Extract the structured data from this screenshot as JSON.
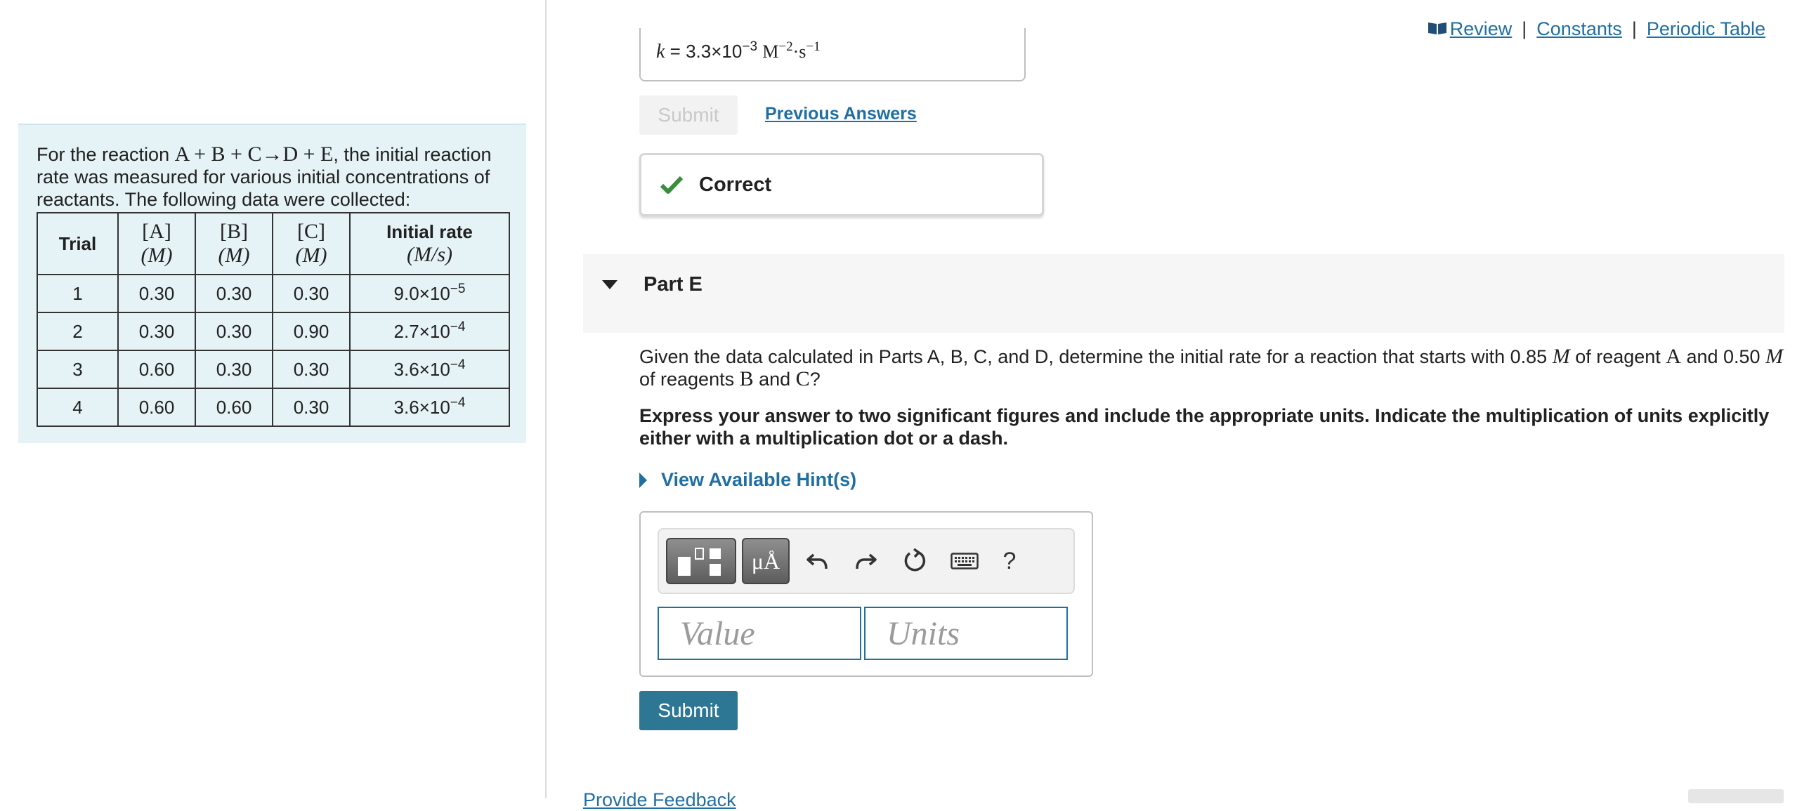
{
  "links": {
    "review": "Review",
    "separator": "|",
    "constants": "Constants",
    "periodic_table": "Periodic Table"
  },
  "problem": {
    "intro_before": "For the reaction ",
    "reaction": "A + B + C→D + E",
    "intro_after": ", the initial reaction rate was measured for various initial concentrations of reactants. The following data were collected:",
    "table": {
      "headers": {
        "trial": "Trial",
        "a": "[A]",
        "b": "[B]",
        "c": "[C]",
        "conc_unit": "(M)",
        "rate": "Initial rate",
        "rate_unit": "(M/s)"
      },
      "rows": [
        {
          "trial": "1",
          "a": "0.30",
          "b": "0.30",
          "c": "0.30",
          "rate_base": "9.0×10",
          "rate_exp": "−5"
        },
        {
          "trial": "2",
          "a": "0.30",
          "b": "0.30",
          "c": "0.90",
          "rate_base": "2.7×10",
          "rate_exp": "−4"
        },
        {
          "trial": "3",
          "a": "0.60",
          "b": "0.30",
          "c": "0.30",
          "rate_base": "3.6×10",
          "rate_exp": "−4"
        },
        {
          "trial": "4",
          "a": "0.60",
          "b": "0.60",
          "c": "0.30",
          "rate_base": "3.6×10",
          "rate_exp": "−4"
        }
      ]
    }
  },
  "previous": {
    "k_label": "k",
    "equals": "=",
    "value_base": "3.3×10",
    "value_exp": "−3",
    "unit_m": "M",
    "unit_m_exp": "−2",
    "unit_dot_s": "·s",
    "unit_s_exp": "−1",
    "submit_label": "Submit",
    "previous_answers_label": "Previous Answers",
    "feedback": "Correct"
  },
  "part": {
    "title": "Part E",
    "question_1": "Given the data calculated in Parts A, B, C, and D, determine the initial rate for a reaction that starts with 0.85 ",
    "question_m1": "M",
    "question_2": " of reagent ",
    "question_a": "A",
    "question_3": " and 0.50 ",
    "question_m2": "M",
    "question_4": " of reagents ",
    "question_b": "B",
    "question_5": " and ",
    "question_c": "C",
    "question_6": "?",
    "instruction": "Express your answer to two significant figures and include the appropriate units. Indicate the multiplication of units explicitly either with a multiplication dot or a dash.",
    "hints_label": "View Available Hint(s)"
  },
  "answer": {
    "toolbar": {
      "template_icon": "template-icon",
      "units_label": "μÅ",
      "undo_icon": "undo-icon",
      "redo_icon": "redo-icon",
      "reset_icon": "reset-icon",
      "keyboard_icon": "keyboard-icon",
      "help_label": "?"
    },
    "value_placeholder": "Value",
    "units_placeholder": "Units",
    "submit_label": "Submit"
  },
  "footer": {
    "feedback_label": "Provide Feedback"
  },
  "colors": {
    "link": "#1f6fa3",
    "submit_bg": "#2d7694",
    "correct_check": "#3a8d3a",
    "problem_bg": "#e5f3f6"
  }
}
